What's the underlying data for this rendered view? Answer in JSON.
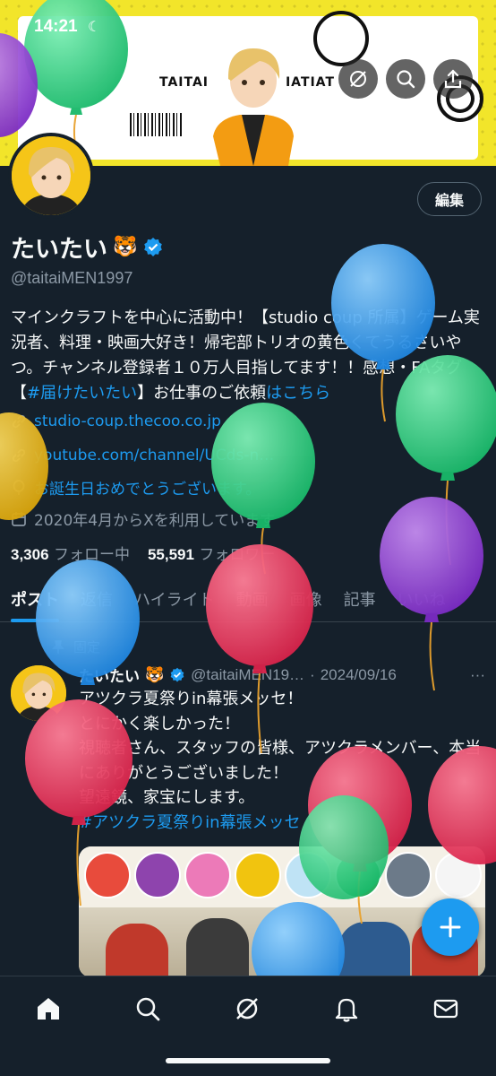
{
  "status_bar": {
    "time": "14:21"
  },
  "banner": {
    "tag_left": "TAITAI",
    "tag_right": "TAITAI",
    "colors": {
      "bg": "#f2e52a"
    }
  },
  "profile": {
    "edit_label": "編集",
    "name": "たいたい",
    "name_emoji": "🐯",
    "handle": "@taitaiMEN1997",
    "bio_line1": "マインクラフトを中心に活動中！【studio coup 所属】ゲーム実況者、料理・映画大好き！帰宅部トリオの黄色くてうるさいやつ。チャンネル登録者１０万人目指してます！！感想・FAタグ【",
    "bio_hashtag": "#届けたいたい",
    "bio_line2": "】お仕事のご依頼",
    "bio_link": "はこちら",
    "link1": "studio-coup.thecoo.co.jp",
    "link2": "youtube.com/channel/UCds-n…",
    "birthday": "お誕生日おめでとうございます。",
    "joined": "2020年4月からXを利用しています",
    "following_count": "3,306",
    "following_label": "フォロー中",
    "followers_count": "55,591",
    "followers_label": "フォロワー"
  },
  "tabs": [
    "ポスト",
    "返信",
    "ハイライト",
    "動画",
    "画像",
    "記事",
    "いいね"
  ],
  "tweet": {
    "pinned_label": "固定",
    "name": "たいたい",
    "emoji": "🐯",
    "handle": "@taitaiMEN19…",
    "sep": "·",
    "date": "2024/09/16",
    "more": "···",
    "line1": "アツクラ夏祭りin幕張メッセ！",
    "line2": "とにかく楽しかった！",
    "line3": "視聴者さん、スタッフの皆様、アツクラメンバー、本当にありがとうございました！",
    "line4": "望遠鏡、家宝にします。",
    "hashtag": "#アツクラ夏祭りin幕張メッセ"
  },
  "colors": {
    "accent": "#1d9bf0",
    "bg": "#15202b",
    "muted": "#8b98a5"
  },
  "nav": [
    "home-icon",
    "search-icon",
    "grok-icon",
    "notifications-icon",
    "messages-icon"
  ]
}
